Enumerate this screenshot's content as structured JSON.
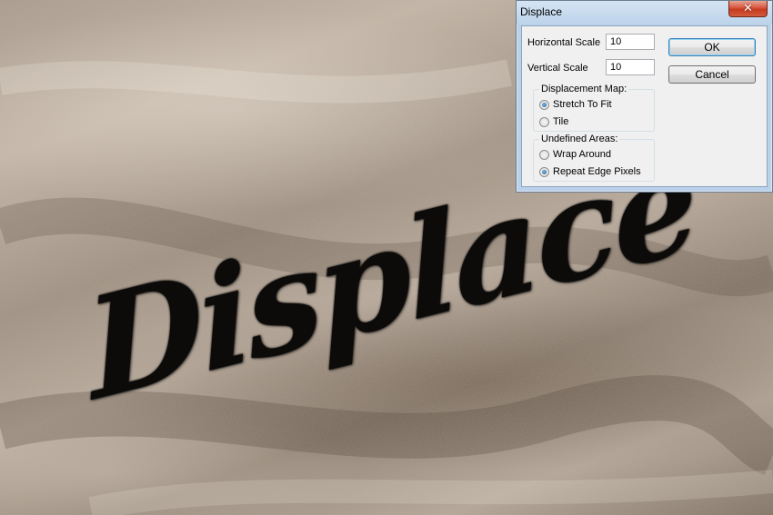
{
  "dialog": {
    "title": "Displace",
    "close_label": "✕",
    "horizontal_scale_label": "Horizontal Scale",
    "horizontal_scale_value": "10",
    "vertical_scale_label": "Vertical Scale",
    "vertical_scale_value": "10",
    "ok_label": "OK",
    "cancel_label": "Cancel",
    "displacement_map": {
      "title": "Displacement Map:",
      "options": [
        "Stretch To Fit",
        "Tile"
      ],
      "selected": "Stretch To Fit"
    },
    "undefined_areas": {
      "title": "Undefined Areas:",
      "options": [
        "Wrap Around",
        "Repeat Edge Pixels"
      ],
      "selected": "Repeat Edge Pixels"
    }
  },
  "canvas": {
    "word": "Displace",
    "background_color": "#b0a293",
    "ink_color": "#0d0b0a"
  }
}
